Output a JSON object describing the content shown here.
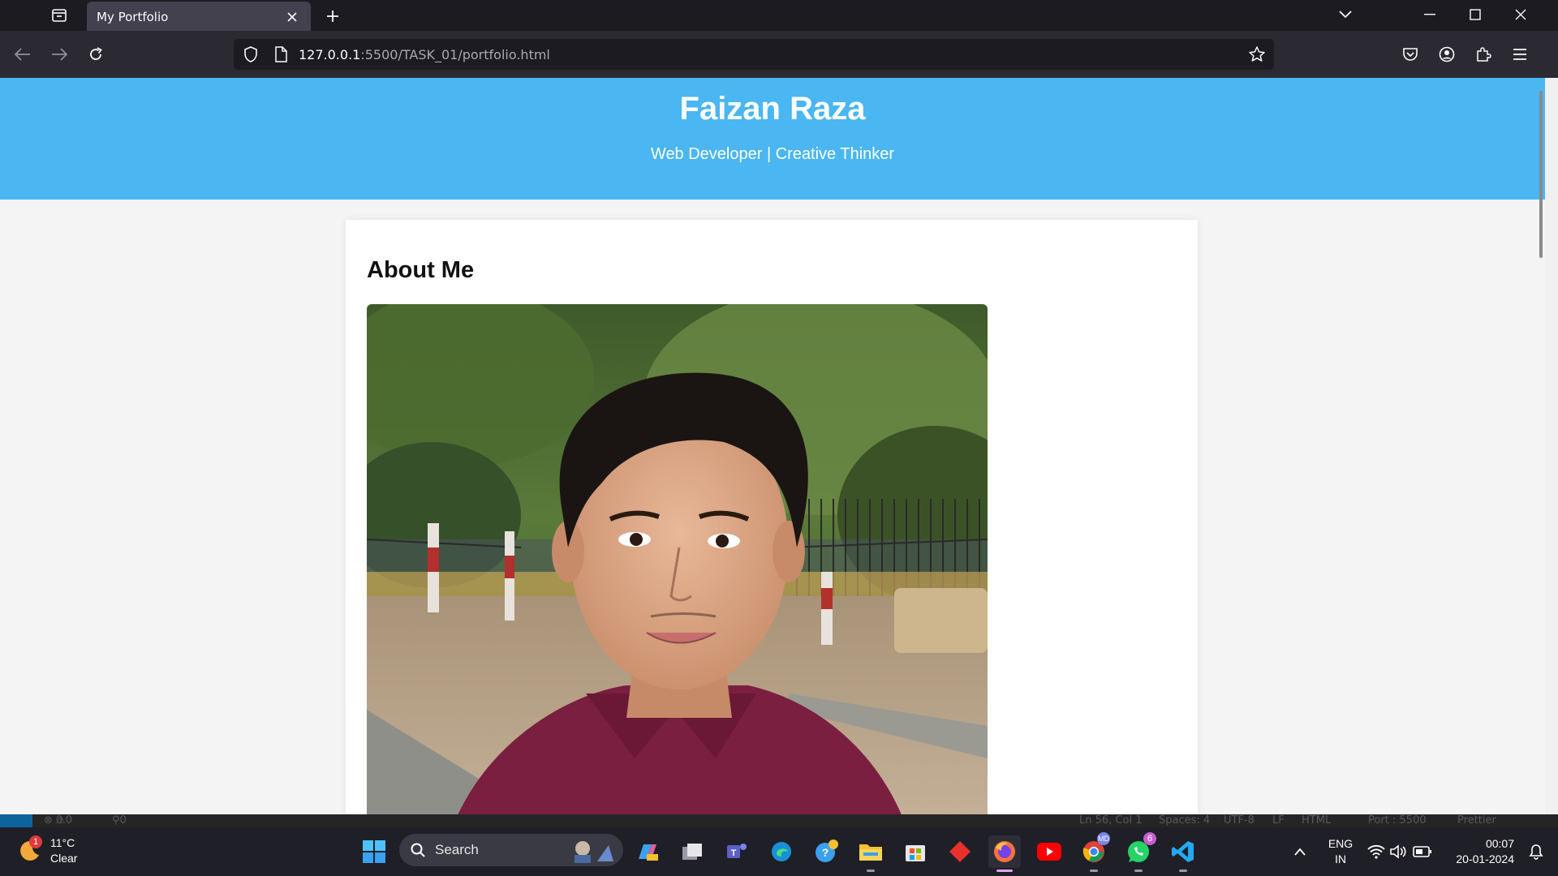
{
  "browser": {
    "tab_title": "My Portfolio",
    "url_host": "127.0.0.1",
    "url_path": ":5500/TASK_01/portfolio.html"
  },
  "page": {
    "name": "Faizan Raza",
    "tagline": "Web Developer | Creative Thinker",
    "section_title": "About Me"
  },
  "vscode_status": {
    "errors": "0",
    "warnings": "0",
    "ports": "0",
    "cursor": "Ln 56, Col 1",
    "spaces": "Spaces: 4",
    "encoding": "UTF-8",
    "eol": "LF",
    "language": "HTML",
    "port": "Port : 5500",
    "formatter": "Prettier"
  },
  "taskbar": {
    "weather_temp": "11°C",
    "weather_desc": "Clear",
    "weather_badge": "1",
    "search_label": "Search",
    "chrome_badge": "MD",
    "whatsapp_badge": "6",
    "lang_top": "ENG",
    "lang_bottom": "IN",
    "time": "00:07",
    "date": "20-01-2024"
  },
  "colors": {
    "header_bg": "#4ab6f2",
    "page_bg": "#f4f4f4",
    "tab_bg": "#42414d"
  }
}
